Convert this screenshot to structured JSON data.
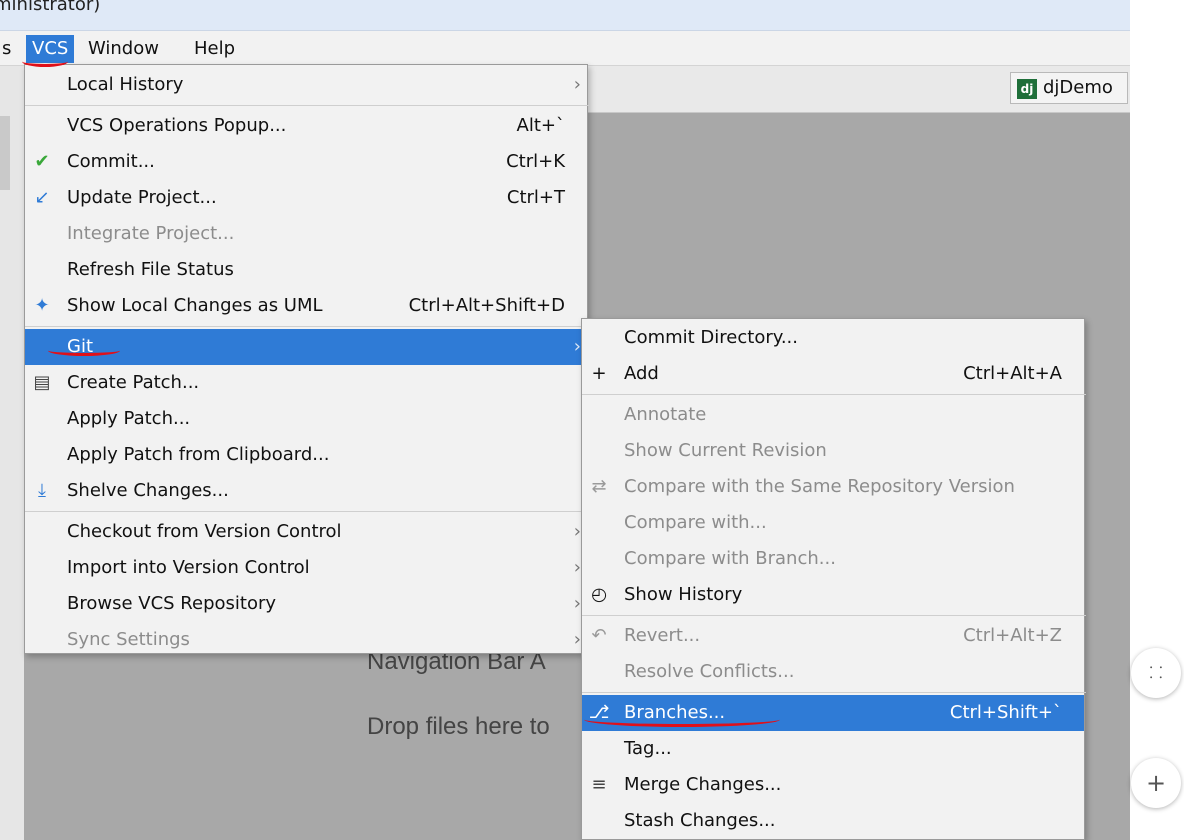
{
  "window": {
    "title_fragment": "ministrator)"
  },
  "menubar": {
    "partial_item": "s",
    "items": [
      {
        "name": "vcs",
        "label": "VCS"
      },
      {
        "name": "window",
        "label": "Window"
      },
      {
        "name": "help",
        "label": "Help"
      }
    ]
  },
  "project_tab": {
    "icon_text": "dj",
    "label": "djDemo"
  },
  "editor_hints": {
    "navigation_bar": "Navigation Bar A",
    "drop_files": "Drop files here to"
  },
  "vcs_menu": {
    "items": [
      {
        "label": "Local History",
        "shortcut": "",
        "submenu": true,
        "icon": "",
        "disabled": false,
        "selected": false
      },
      {
        "label": "VCS Operations Popup...",
        "shortcut": "Alt+`",
        "submenu": false,
        "icon": "",
        "disabled": false,
        "selected": false
      },
      {
        "label": "Commit...",
        "shortcut": "Ctrl+K",
        "submenu": false,
        "icon": "check-icon",
        "disabled": false,
        "selected": false
      },
      {
        "label": "Update Project...",
        "shortcut": "Ctrl+T",
        "submenu": false,
        "icon": "update-arrow-icon",
        "disabled": false,
        "selected": false
      },
      {
        "label": "Integrate Project...",
        "shortcut": "",
        "submenu": false,
        "icon": "",
        "disabled": true,
        "selected": false
      },
      {
        "label": "Refresh File Status",
        "shortcut": "",
        "submenu": false,
        "icon": "",
        "disabled": false,
        "selected": false
      },
      {
        "label": "Show Local Changes as UML",
        "shortcut": "Ctrl+Alt+Shift+D",
        "submenu": false,
        "icon": "uml-icon",
        "disabled": false,
        "selected": false
      },
      {
        "label": "Git",
        "shortcut": "",
        "submenu": true,
        "icon": "",
        "disabled": false,
        "selected": true
      },
      {
        "label": "Create Patch...",
        "shortcut": "",
        "submenu": false,
        "icon": "patch-icon",
        "disabled": false,
        "selected": false
      },
      {
        "label": "Apply Patch...",
        "shortcut": "",
        "submenu": false,
        "icon": "",
        "disabled": false,
        "selected": false
      },
      {
        "label": "Apply Patch from Clipboard...",
        "shortcut": "",
        "submenu": false,
        "icon": "",
        "disabled": false,
        "selected": false
      },
      {
        "label": "Shelve Changes...",
        "shortcut": "",
        "submenu": false,
        "icon": "shelve-icon",
        "disabled": false,
        "selected": false
      },
      {
        "label": "Checkout from Version Control",
        "shortcut": "",
        "submenu": true,
        "icon": "",
        "disabled": false,
        "selected": false
      },
      {
        "label": "Import into Version Control",
        "shortcut": "",
        "submenu": true,
        "icon": "",
        "disabled": false,
        "selected": false
      },
      {
        "label": "Browse VCS Repository",
        "shortcut": "",
        "submenu": true,
        "icon": "",
        "disabled": false,
        "selected": false
      },
      {
        "label": "Sync Settings",
        "shortcut": "",
        "submenu": true,
        "icon": "",
        "disabled": true,
        "selected": false
      }
    ]
  },
  "git_menu": {
    "items": [
      {
        "label": "Commit Directory...",
        "shortcut": "",
        "icon": "",
        "disabled": false,
        "selected": false
      },
      {
        "label": "Add",
        "shortcut": "Ctrl+Alt+A",
        "icon": "plus-icon",
        "disabled": false,
        "selected": false
      },
      {
        "label": "Annotate",
        "shortcut": "",
        "icon": "",
        "disabled": true,
        "selected": false
      },
      {
        "label": "Show Current Revision",
        "shortcut": "",
        "icon": "",
        "disabled": true,
        "selected": false
      },
      {
        "label": "Compare with the Same Repository Version",
        "shortcut": "",
        "icon": "compare-icon",
        "disabled": true,
        "selected": false
      },
      {
        "label": "Compare with...",
        "shortcut": "",
        "icon": "",
        "disabled": true,
        "selected": false
      },
      {
        "label": "Compare with Branch...",
        "shortcut": "",
        "icon": "",
        "disabled": true,
        "selected": false
      },
      {
        "label": "Show History",
        "shortcut": "",
        "icon": "clock-icon",
        "disabled": false,
        "selected": false
      },
      {
        "label": "Revert...",
        "shortcut": "Ctrl+Alt+Z",
        "icon": "revert-icon",
        "disabled": true,
        "selected": false
      },
      {
        "label": "Resolve Conflicts...",
        "shortcut": "",
        "icon": "",
        "disabled": true,
        "selected": false
      },
      {
        "label": "Branches...",
        "shortcut": "Ctrl+Shift+`",
        "icon": "branch-icon",
        "disabled": false,
        "selected": true
      },
      {
        "label": "Tag...",
        "shortcut": "",
        "icon": "",
        "disabled": false,
        "selected": false
      },
      {
        "label": "Merge Changes...",
        "shortcut": "",
        "icon": "merge-icon",
        "disabled": false,
        "selected": false
      },
      {
        "label": "Stash Changes...",
        "shortcut": "",
        "icon": "",
        "disabled": false,
        "selected": false
      }
    ]
  },
  "floating_buttons": [
    {
      "name": "collapse-button",
      "icon": "collapse-icon"
    },
    {
      "name": "zoom-in-button",
      "icon": "plus-icon"
    }
  ],
  "colors": {
    "selection": "#2f7bd6",
    "annotation": "#e0101a",
    "check": "#3aa83a"
  }
}
